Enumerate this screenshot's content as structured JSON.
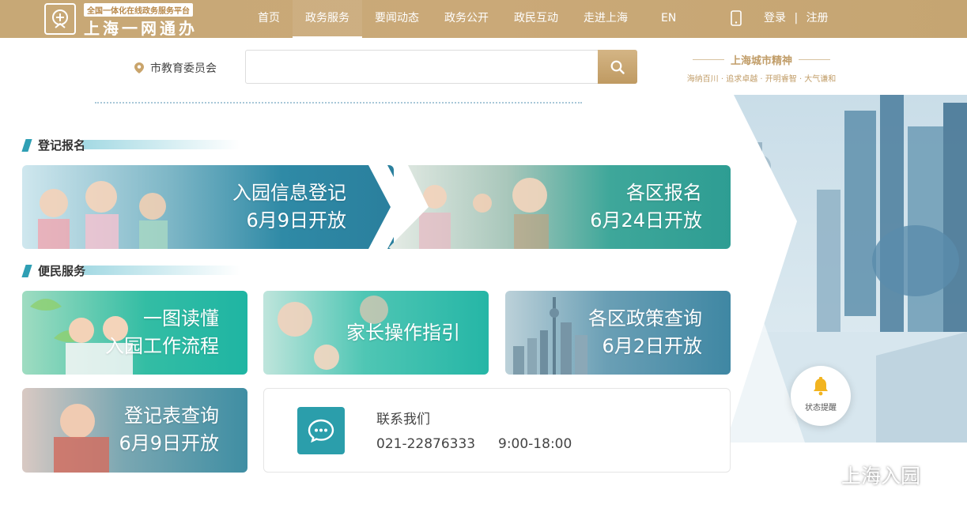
{
  "header": {
    "logo_tag": "全国一体化在线政务服务平台",
    "logo_name": "上海一网通办",
    "nav": [
      "首页",
      "政务服务",
      "要闻动态",
      "政务公开",
      "政民互动",
      "走进上海"
    ],
    "active_nav": "政务服务",
    "lang": "EN",
    "login": "登录",
    "separator": "|",
    "register": "注册"
  },
  "search": {
    "location": "市教育委员会",
    "placeholder": ""
  },
  "spirit": {
    "title": "上海城市精神",
    "subtitle": "海纳百川 · 追求卓越 · 开明睿智 · 大气谦和"
  },
  "sections": {
    "register": "登记报名",
    "service": "便民服务"
  },
  "cards": {
    "entry_info": {
      "line1": "入园信息登记",
      "line2": "6月9日开放"
    },
    "district_signup": {
      "line1": "各区报名",
      "line2": "6月24日开放"
    },
    "process": {
      "line1": "一图读懂",
      "line2": "入园工作流程"
    },
    "guide": {
      "line1": "家长操作指引"
    },
    "policy": {
      "line1": "各区政策查询",
      "line2": "6月2日开放"
    },
    "form_query": {
      "line1": "登记表查询",
      "line2": "6月9日开放"
    }
  },
  "contact": {
    "label": "联系我们",
    "phone": "021-22876333",
    "hours": "9:00-18:00"
  },
  "status_button": "状态提醒",
  "watermark": "上海入园",
  "colors": {
    "header_gold": "#c7a876",
    "teal": "#2b9eab",
    "teal_green": "#2fb3a0"
  }
}
